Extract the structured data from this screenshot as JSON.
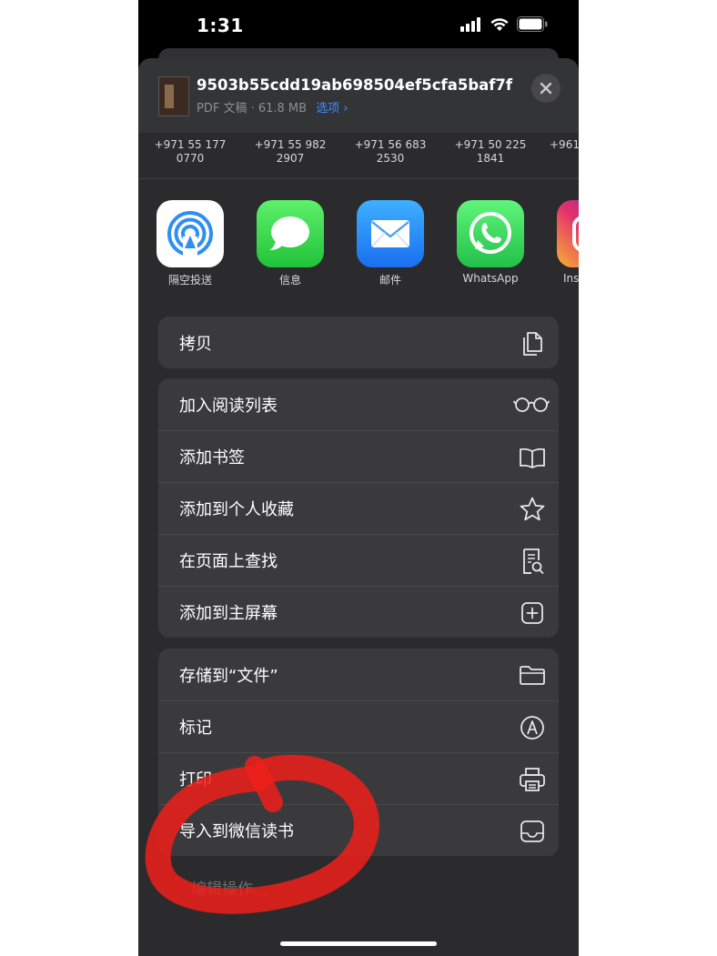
{
  "status_bar": {
    "time": "1:31"
  },
  "share_header": {
    "file_name": "9503b55cdd19ab698504ef5cfa5baf7f",
    "file_info": "PDF 文稿 · 61.8 MB",
    "options_label": "选项 ›"
  },
  "contacts": [
    {
      "line1": "+971 55 177",
      "line2": "0770"
    },
    {
      "line1": "+971 55 982",
      "line2": "2907"
    },
    {
      "line1": "+971 56 683",
      "line2": "2530"
    },
    {
      "line1": "+971 50 225",
      "line2": "1841"
    },
    {
      "line1": "+961",
      "line2": ""
    }
  ],
  "apps": [
    {
      "label": "隔空投送",
      "icon": "airdrop-icon"
    },
    {
      "label": "信息",
      "icon": "messages-icon"
    },
    {
      "label": "邮件",
      "icon": "mail-icon"
    },
    {
      "label": "WhatsApp",
      "icon": "whatsapp-icon"
    },
    {
      "label": "Ins",
      "icon": "instagram-icon"
    }
  ],
  "actions_group_1": [
    {
      "label": "拷贝",
      "icon": "copy-icon"
    }
  ],
  "actions_group_2": [
    {
      "label": "加入阅读列表",
      "icon": "glasses-icon"
    },
    {
      "label": "添加书签",
      "icon": "book-icon"
    },
    {
      "label": "添加到个人收藏",
      "icon": "star-icon"
    },
    {
      "label": "在页面上查找",
      "icon": "find-doc-icon"
    },
    {
      "label": "添加到主屏幕",
      "icon": "plus-square-icon"
    }
  ],
  "actions_group_3": [
    {
      "label": "存储到“文件”",
      "icon": "folder-icon"
    },
    {
      "label": "标记",
      "icon": "markup-icon"
    },
    {
      "label": "打印",
      "icon": "printer-icon"
    },
    {
      "label": "导入到微信读书",
      "icon": "tray-icon"
    }
  ],
  "more_actions_label": "编辑操作...",
  "colors": {
    "sheet_background": "#2b2b2d",
    "row_background": "#3a3a3c",
    "link_blue": "#3f8cff",
    "annotation_red": "#f0201a"
  }
}
